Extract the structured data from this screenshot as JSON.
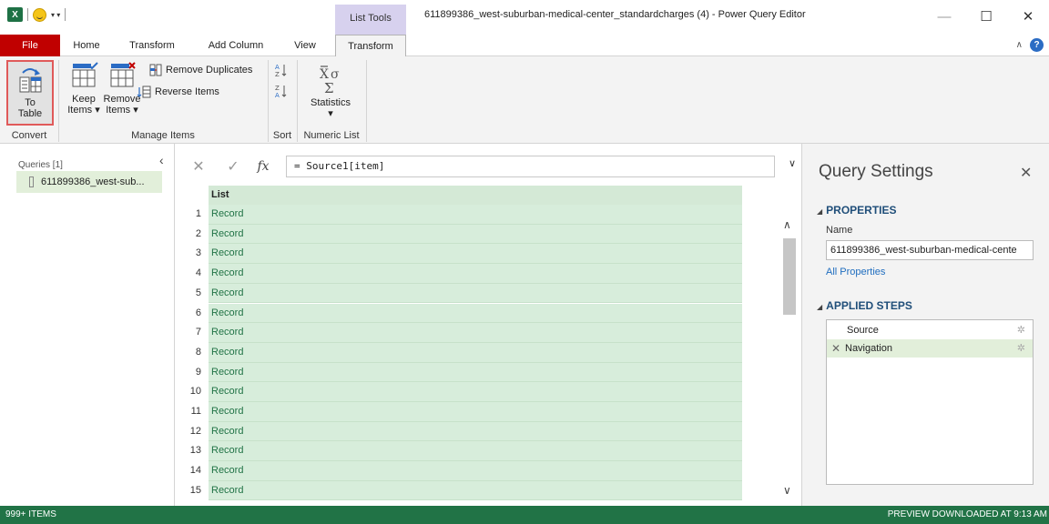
{
  "titlebar": {
    "app_icon": "X",
    "contextual_tab": "List Tools",
    "title": "611899386_west-suburban-medical-center_standardcharges (4) - Power Query Editor",
    "minimize": "—",
    "maximize": "☐",
    "close": "✕"
  },
  "tabs": {
    "file": "File",
    "home": "Home",
    "transform": "Transform",
    "add_column": "Add Column",
    "view": "View",
    "list_transform": "Transform",
    "help": "?"
  },
  "ribbon": {
    "to_table_line1": "To",
    "to_table_line2": "Table",
    "convert_label": "Convert",
    "keep_items_line1": "Keep",
    "keep_items_line2": "Items ▾",
    "remove_items_line1": "Remove",
    "remove_items_line2": "Items ▾",
    "remove_duplicates": "Remove Duplicates",
    "reverse_items": "Reverse Items",
    "manage_items_label": "Manage Items",
    "sort_label": "Sort",
    "statistics": "Statistics",
    "statistics_caret": "▾",
    "numeric_list_label": "Numeric List"
  },
  "queries": {
    "label": "Queries [1]",
    "items": [
      {
        "name": "611899386_west-sub..."
      }
    ]
  },
  "formula": {
    "cancel": "✕",
    "confirm": "✓",
    "fx": "fx",
    "value": "= Source1[item]",
    "expand": "∨"
  },
  "grid": {
    "column_header": "List",
    "rows": [
      {
        "num": "1",
        "value": "Record"
      },
      {
        "num": "2",
        "value": "Record"
      },
      {
        "num": "3",
        "value": "Record"
      },
      {
        "num": "4",
        "value": "Record"
      },
      {
        "num": "5",
        "value": "Record"
      },
      {
        "num": "6",
        "value": "Record"
      },
      {
        "num": "7",
        "value": "Record"
      },
      {
        "num": "8",
        "value": "Record"
      },
      {
        "num": "9",
        "value": "Record"
      },
      {
        "num": "10",
        "value": "Record"
      },
      {
        "num": "11",
        "value": "Record"
      },
      {
        "num": "12",
        "value": "Record"
      },
      {
        "num": "13",
        "value": "Record"
      },
      {
        "num": "14",
        "value": "Record"
      },
      {
        "num": "15",
        "value": "Record"
      }
    ]
  },
  "settings": {
    "title": "Query Settings",
    "properties_head": "PROPERTIES",
    "name_label": "Name",
    "name_value": "611899386_west-suburban-medical-cente",
    "all_properties": "All Properties",
    "applied_steps_head": "APPLIED STEPS",
    "steps": [
      {
        "label": "Source"
      },
      {
        "label": "Navigation"
      }
    ]
  },
  "statusbar": {
    "left": "999+ ITEMS",
    "right": "PREVIEW DOWNLOADED AT 9:13 AM"
  },
  "colors": {
    "file_tab": "#c00000",
    "status_bar": "#217346",
    "selection": "#e2efda",
    "grid_cell": "#d7eddb",
    "contextual": "#d7d1ee"
  }
}
